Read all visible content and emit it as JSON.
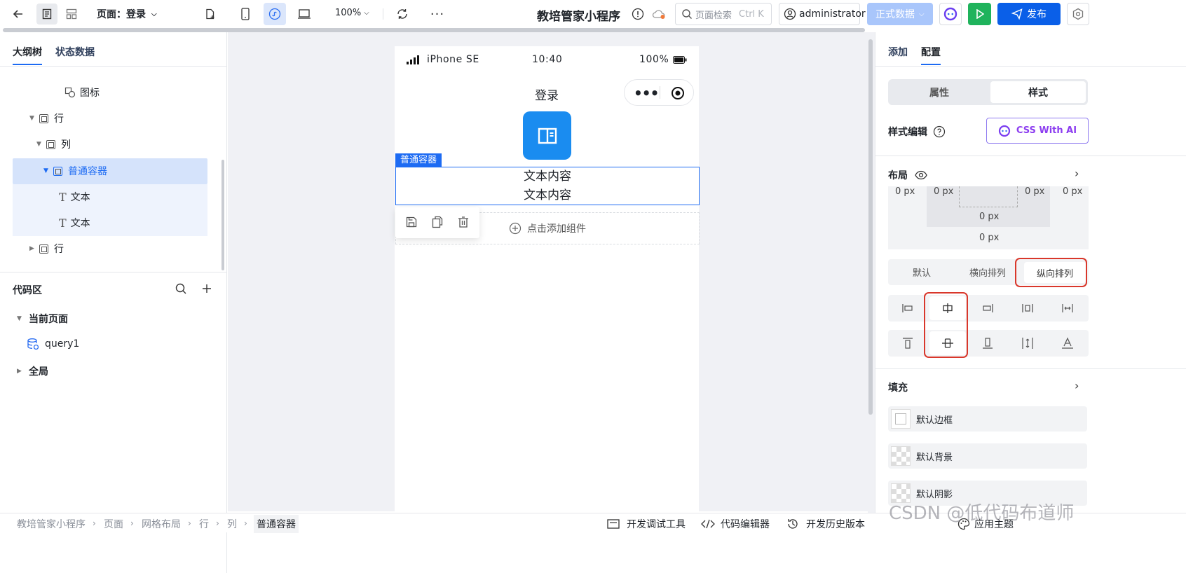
{
  "topbar": {
    "page_label": "页面：登录",
    "zoom": "100%",
    "app_title": "教培管家小程序",
    "search_placeholder": "页面检索",
    "search_shortcut": "Ctrl K",
    "user": "administrator",
    "env": "正式数据",
    "publish": "发布"
  },
  "left": {
    "tabs": [
      "大纲树",
      "状态数据"
    ],
    "tree": [
      "图标",
      "行",
      "列",
      "普通容器",
      "文本",
      "文本",
      "行"
    ],
    "code_title": "代码区",
    "current_page": "当前页面",
    "query": "query1",
    "global": "全局"
  },
  "phone": {
    "device": "iPhone SE",
    "time": "10:40",
    "battery": "100%",
    "title": "登录",
    "container_tag": "普通容器",
    "text1": "文本内容",
    "text2": "文本内容",
    "add_component": "点击添加组件"
  },
  "right": {
    "tabs": [
      "添加",
      "配置"
    ],
    "seg": [
      "属性",
      "样式"
    ],
    "style_edit": "样式编辑",
    "css_ai": "CSS With AI",
    "layout": "布局",
    "px_values": [
      "0 px",
      "0 px",
      "0 px",
      "0 px",
      "0 px",
      "0 px"
    ],
    "direction": [
      "默认",
      "横向排列",
      "纵向排列"
    ],
    "fill": "填充",
    "fill_items": [
      "默认边框",
      "默认背景",
      "默认阴影"
    ]
  },
  "bottom": {
    "breadcrumb": [
      "教培管家小程序",
      "页面",
      "网格布局",
      "行",
      "列",
      "普通容器"
    ],
    "tools": [
      "开发调试工具",
      "代码编辑器",
      "开发历史版本",
      "应用主题"
    ]
  },
  "watermark": "CSDN @低代码布道师",
  "colors": {
    "accent": "#1d6bf3",
    "publish_bg": "#0a5fe8",
    "run_bg": "#1fb35c",
    "env_bg": "#a9c6fb",
    "highlight_red": "#d9372b",
    "selected_row": "#d5e3fb"
  }
}
